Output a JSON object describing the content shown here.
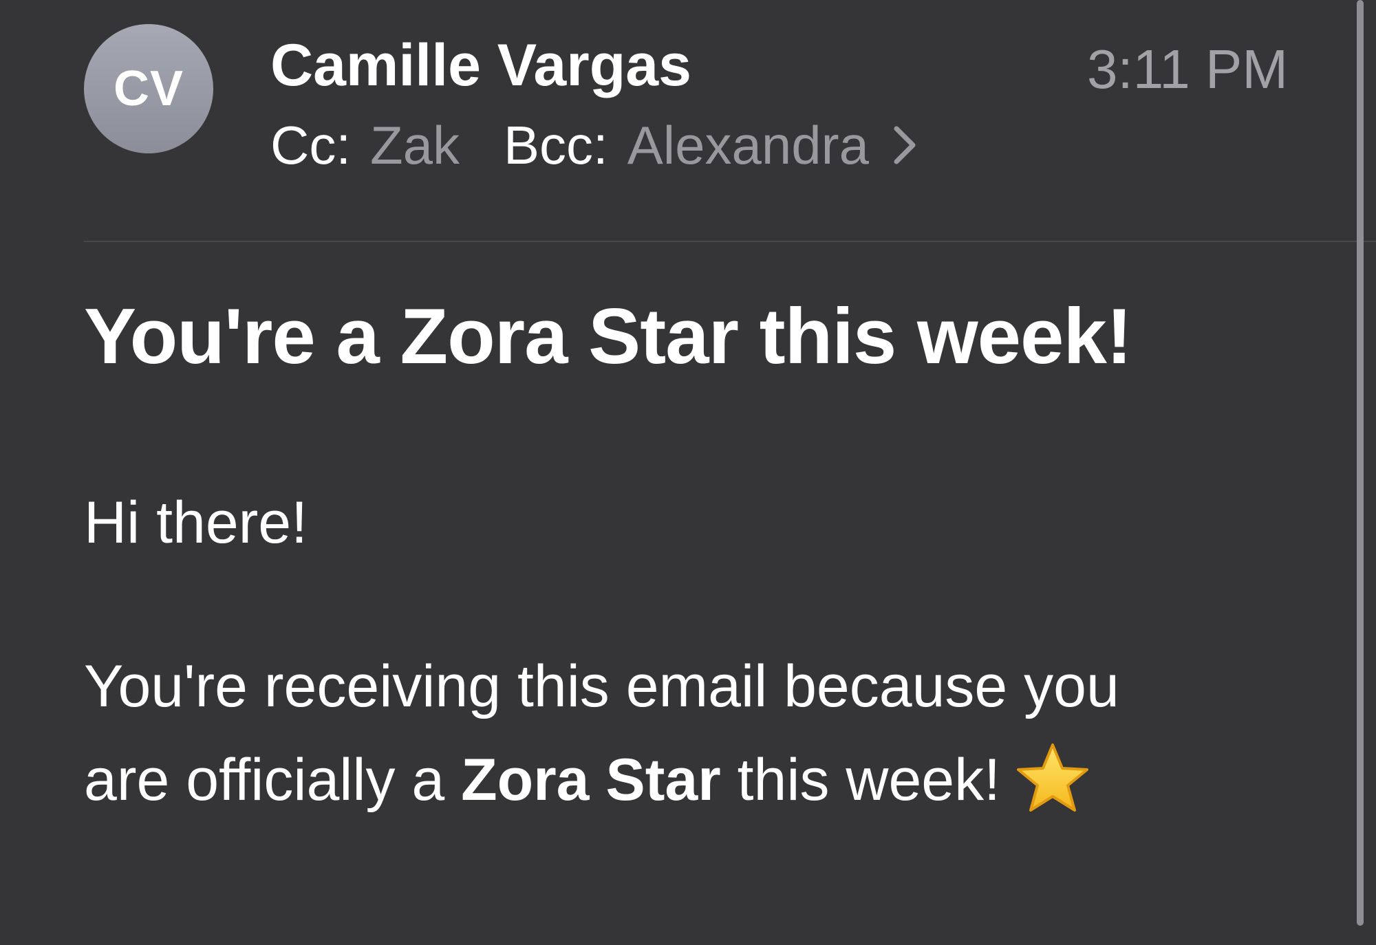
{
  "sender": {
    "initials": "CV",
    "name": "Camille Vargas",
    "time": "3:11 PM"
  },
  "recipients": {
    "cc_label": "Cc:",
    "cc_value": "Zak",
    "bcc_label": "Bcc:",
    "bcc_value": "Alexandra",
    "expand_icon": "chevron-right-icon"
  },
  "message": {
    "subject": "You're a Zora Star this week!",
    "greeting": "Hi there!",
    "body_part1": "You're receiving this email because you are officially a",
    "body_bold": "Zora Star",
    "body_part2": "this week!",
    "emoji_icon": "star-icon"
  },
  "colors": {
    "background": "#353538",
    "secondary_text": "#98989d",
    "avatar": "#9a9ca6",
    "star": "#f7c52b"
  }
}
